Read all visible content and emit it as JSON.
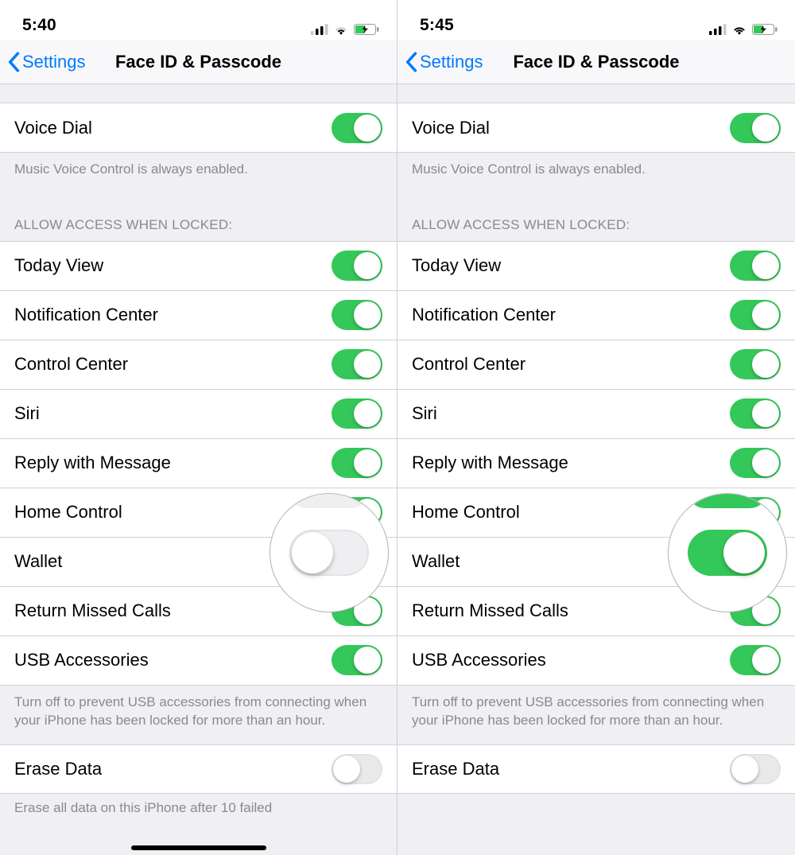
{
  "screens": [
    {
      "time": "5:40",
      "back_label": "Settings",
      "title": "Face ID & Passcode",
      "voice_dial": {
        "label": "Voice Dial",
        "on": true
      },
      "voice_footer": "Music Voice Control is always enabled.",
      "locked_header": "ALLOW ACCESS WHEN LOCKED:",
      "rows": [
        {
          "label": "Today View",
          "on": true
        },
        {
          "label": "Notification Center",
          "on": true
        },
        {
          "label": "Control Center",
          "on": true
        },
        {
          "label": "Siri",
          "on": true
        },
        {
          "label": "Reply with Message",
          "on": true
        },
        {
          "label": "Home Control",
          "on": true
        },
        {
          "label": "Wallet",
          "on": false
        },
        {
          "label": "Return Missed Calls",
          "on": true
        },
        {
          "label": "USB Accessories",
          "on": true
        }
      ],
      "usb_footer": "Turn off to prevent USB accessories from connecting when your iPhone has been locked for more than an hour.",
      "erase": {
        "label": "Erase Data",
        "on": false
      },
      "erase_footer_truncated": "Erase all data on this iPhone after 10 failed",
      "zoom_on": false
    },
    {
      "time": "5:45",
      "back_label": "Settings",
      "title": "Face ID & Passcode",
      "voice_dial": {
        "label": "Voice Dial",
        "on": true
      },
      "voice_footer": "Music Voice Control is always enabled.",
      "locked_header": "ALLOW ACCESS WHEN LOCKED:",
      "rows": [
        {
          "label": "Today View",
          "on": true
        },
        {
          "label": "Notification Center",
          "on": true
        },
        {
          "label": "Control Center",
          "on": true
        },
        {
          "label": "Siri",
          "on": true
        },
        {
          "label": "Reply with Message",
          "on": true
        },
        {
          "label": "Home Control",
          "on": true
        },
        {
          "label": "Wallet",
          "on": true
        },
        {
          "label": "Return Missed Calls",
          "on": true
        },
        {
          "label": "USB Accessories",
          "on": true
        }
      ],
      "usb_footer": "Turn off to prevent USB accessories from connecting when your iPhone has been locked for more than an hour.",
      "erase": {
        "label": "Erase Data",
        "on": false
      },
      "erase_footer_truncated": "",
      "zoom_on": true
    }
  ]
}
